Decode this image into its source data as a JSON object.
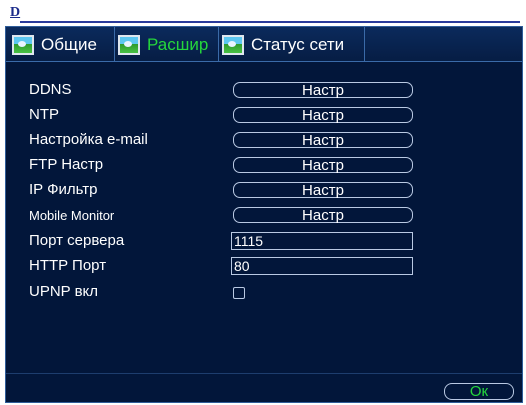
{
  "window": {
    "label": "D"
  },
  "tabs": [
    {
      "label": "Общие",
      "active": false,
      "icon": "landscape-icon"
    },
    {
      "label": "Расшир",
      "active": true,
      "icon": "landscape-icon"
    },
    {
      "label": "Статус сети",
      "active": false,
      "icon": "landscape-icon"
    }
  ],
  "rows": [
    {
      "label": "DDNS",
      "control": "button",
      "value": "Настр"
    },
    {
      "label": "NTP",
      "control": "button",
      "value": "Настр"
    },
    {
      "label": "Настройка e-mail",
      "control": "button",
      "value": "Настр"
    },
    {
      "label": "FTP Настр",
      "control": "button",
      "value": "Настр"
    },
    {
      "label": "IP Фильтр",
      "control": "button",
      "value": "Настр"
    },
    {
      "label": "Mobile Monitor",
      "control": "button",
      "value": "Настр"
    },
    {
      "label": "Порт сервера",
      "control": "input",
      "value": "1115"
    },
    {
      "label": "HTTP Порт",
      "control": "input",
      "value": "80"
    },
    {
      "label": "UPNP вкл",
      "control": "checkbox",
      "checked": false
    }
  ],
  "footer": {
    "ok_label": "Ок"
  },
  "colors": {
    "panel_bg": "#02163a",
    "active_tab": "#25d63c",
    "text": "#ffffff",
    "border": "#b9c9e3"
  }
}
